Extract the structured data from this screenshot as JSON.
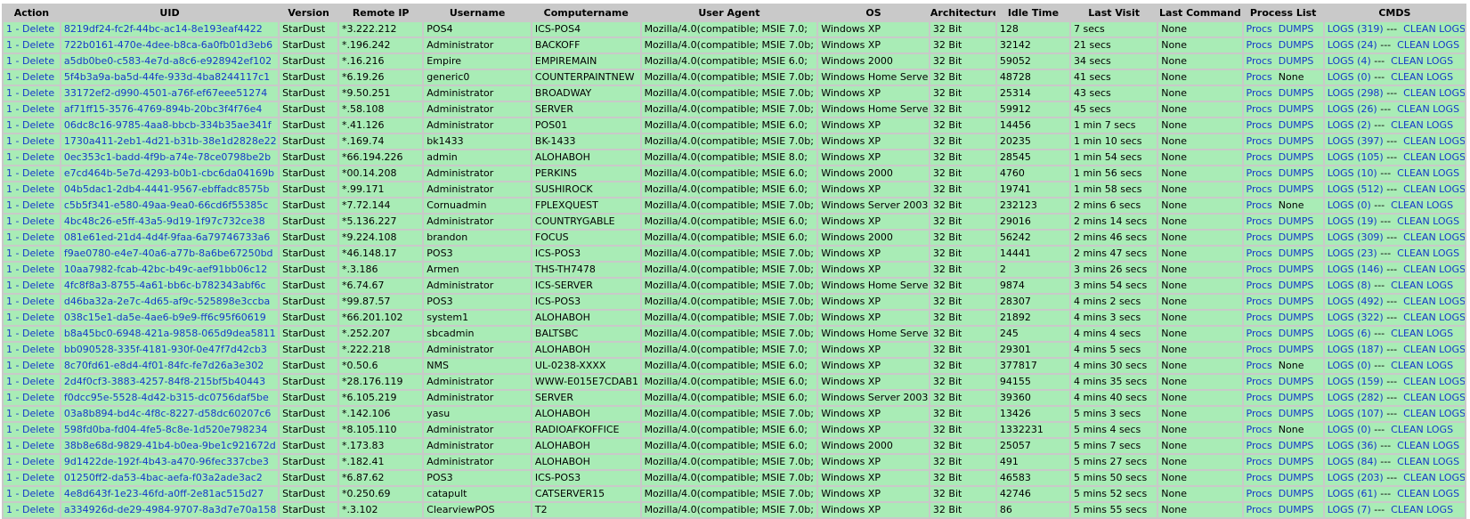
{
  "headers": [
    "Action",
    "UID",
    "Version",
    "Remote IP",
    "Username",
    "Computername",
    "User Agent",
    "OS",
    "Architecture",
    "Idle Time",
    "Last Visit",
    "Last Command",
    "Process List",
    "CMDS"
  ],
  "action_prefix": "1 -",
  "action_label": "Delete",
  "procs_label": "Procs",
  "dumps_label": "DUMPS",
  "cmds_separator": "---",
  "clean_label": "CLEAN LOGS",
  "rows": [
    {
      "uid": "8219df24-fc2f-44bc-ac14-8e193eaf4422",
      "version": "StarDust",
      "ip": "*3.222.212",
      "user": "POS4",
      "comp": "ICS-POS4",
      "ua": "Mozilla/4.0(compatible; MSIE 7.0;",
      "os": "Windows XP",
      "arch": "32 Bit",
      "idle": "128",
      "visit": "7 secs",
      "cmd": "None",
      "dumps": "DUMPS",
      "logs": "LOGS (319)"
    },
    {
      "uid": "722b0161-470e-4dee-b8ca-6a0fb01d3eb6",
      "version": "StarDust",
      "ip": "*.196.242",
      "user": "Administrator",
      "comp": "BACKOFF",
      "ua": "Mozilla/4.0(compatible; MSIE 7.0b;",
      "os": "Windows XP",
      "arch": "32 Bit",
      "idle": "32142",
      "visit": "21 secs",
      "cmd": "None",
      "dumps": "DUMPS",
      "logs": "LOGS (24)"
    },
    {
      "uid": "a5db0be0-c583-4e7d-a8c6-e928942ef102",
      "version": "StarDust",
      "ip": "*.16.216",
      "user": "Empire",
      "comp": "EMPIREMAIN",
      "ua": "Mozilla/4.0(compatible; MSIE 6.0;",
      "os": "Windows 2000",
      "arch": "32 Bit",
      "idle": "59052",
      "visit": "34 secs",
      "cmd": "None",
      "dumps": "DUMPS",
      "logs": "LOGS (4)"
    },
    {
      "uid": "5f4b3a9a-ba5d-44fe-933d-4ba8244117c1",
      "version": "StarDust",
      "ip": "*6.19.26",
      "user": "generic0",
      "comp": "COUNTERPAINTNEW",
      "ua": "Mozilla/4.0(compatible; MSIE 7.0b;",
      "os": "Windows Home Server",
      "arch": "32 Bit",
      "idle": "48728",
      "visit": "41 secs",
      "cmd": "None",
      "dumps": "None",
      "logs": "LOGS (0)"
    },
    {
      "uid": "33172ef2-d990-4501-a76f-ef67eee51274",
      "version": "StarDust",
      "ip": "*9.50.251",
      "user": "Administrator",
      "comp": "BROADWAY",
      "ua": "Mozilla/4.0(compatible; MSIE 7.0b;",
      "os": "Windows XP",
      "arch": "32 Bit",
      "idle": "25314",
      "visit": "43 secs",
      "cmd": "None",
      "dumps": "DUMPS",
      "logs": "LOGS (298)"
    },
    {
      "uid": "af71ff15-3576-4769-894b-20bc3f4f76e4",
      "version": "StarDust",
      "ip": "*.58.108",
      "user": "Administrator",
      "comp": "SERVER",
      "ua": "Mozilla/4.0(compatible; MSIE 7.0b;",
      "os": "Windows Home Server",
      "arch": "32 Bit",
      "idle": "59912",
      "visit": "45 secs",
      "cmd": "None",
      "dumps": "DUMPS",
      "logs": "LOGS (26)"
    },
    {
      "uid": "06dc8c16-9785-4aa8-bbcb-334b35ae341f",
      "version": "StarDust",
      "ip": "*.41.126",
      "user": "Administrator",
      "comp": "POS01",
      "ua": "Mozilla/4.0(compatible; MSIE 6.0;",
      "os": "Windows XP",
      "arch": "32 Bit",
      "idle": "14456",
      "visit": "1 min 7 secs",
      "cmd": "None",
      "dumps": "DUMPS",
      "logs": "LOGS (2)"
    },
    {
      "uid": "1730a411-2eb1-4d21-b31b-38e1d2828e22",
      "version": "StarDust",
      "ip": "*.169.74",
      "user": "bk1433",
      "comp": "BK-1433",
      "ua": "Mozilla/4.0(compatible; MSIE 7.0b;",
      "os": "Windows XP",
      "arch": "32 Bit",
      "idle": "20235",
      "visit": "1 min 10 secs",
      "cmd": "None",
      "dumps": "DUMPS",
      "logs": "LOGS (397)"
    },
    {
      "uid": "0ec353c1-badd-4f9b-a74e-78ce0798be2b",
      "version": "StarDust",
      "ip": "*66.194.226",
      "user": "admin",
      "comp": "ALOHABOH",
      "ua": "Mozilla/4.0(compatible; MSIE 8.0;",
      "os": "Windows XP",
      "arch": "32 Bit",
      "idle": "28545",
      "visit": "1 min 54 secs",
      "cmd": "None",
      "dumps": "DUMPS",
      "logs": "LOGS (105)"
    },
    {
      "uid": "e7cd464b-5e7d-4293-b0b1-cbc6da04169b",
      "version": "StarDust",
      "ip": "*00.14.208",
      "user": "Administrator",
      "comp": "PERKINS",
      "ua": "Mozilla/4.0(compatible; MSIE 6.0;",
      "os": "Windows 2000",
      "arch": "32 Bit",
      "idle": "4760",
      "visit": "1 min 56 secs",
      "cmd": "None",
      "dumps": "DUMPS",
      "logs": "LOGS (10)"
    },
    {
      "uid": "04b5dac1-2db4-4441-9567-ebffadc8575b",
      "version": "StarDust",
      "ip": "*.99.171",
      "user": "Administrator",
      "comp": "SUSHIROCK",
      "ua": "Mozilla/4.0(compatible; MSIE 6.0;",
      "os": "Windows XP",
      "arch": "32 Bit",
      "idle": "19741",
      "visit": "1 min 58 secs",
      "cmd": "None",
      "dumps": "DUMPS",
      "logs": "LOGS (512)"
    },
    {
      "uid": "c5b5f341-e580-49aa-9ea0-66cd6f55385c",
      "version": "StarDust",
      "ip": "*7.72.144",
      "user": "Cornuadmin",
      "comp": "FPLEXQUEST",
      "ua": "Mozilla/4.0(compatible; MSIE 7.0b;",
      "os": "Windows Server 2003",
      "arch": "32 Bit",
      "idle": "232123",
      "visit": "2 mins 6 secs",
      "cmd": "None",
      "dumps": "None",
      "logs": "LOGS (0)"
    },
    {
      "uid": "4bc48c26-e5ff-43a5-9d19-1f97c732ce38",
      "version": "StarDust",
      "ip": "*5.136.227",
      "user": "Administrator",
      "comp": "COUNTRYGABLE",
      "ua": "Mozilla/4.0(compatible; MSIE 6.0;",
      "os": "Windows XP",
      "arch": "32 Bit",
      "idle": "29016",
      "visit": "2 mins 14 secs",
      "cmd": "None",
      "dumps": "DUMPS",
      "logs": "LOGS (19)"
    },
    {
      "uid": "081e61ed-21d4-4d4f-9faa-6a79746733a6",
      "version": "StarDust",
      "ip": "*9.224.108",
      "user": "brandon",
      "comp": "FOCUS",
      "ua": "Mozilla/4.0(compatible; MSIE 6.0;",
      "os": "Windows 2000",
      "arch": "32 Bit",
      "idle": "56242",
      "visit": "2 mins 46 secs",
      "cmd": "None",
      "dumps": "DUMPS",
      "logs": "LOGS (309)"
    },
    {
      "uid": "f9ae0780-e4e7-40a6-a77b-8a6be67250bd",
      "version": "StarDust",
      "ip": "*46.148.17",
      "user": "POS3",
      "comp": "ICS-POS3",
      "ua": "Mozilla/4.0(compatible; MSIE 7.0b;",
      "os": "Windows XP",
      "arch": "32 Bit",
      "idle": "14441",
      "visit": "2 mins 47 secs",
      "cmd": "None",
      "dumps": "DUMPS",
      "logs": "LOGS (23)"
    },
    {
      "uid": "10aa7982-fcab-42bc-b49c-aef91bb06c12",
      "version": "StarDust",
      "ip": "*.3.186",
      "user": "Armen",
      "comp": "THS-TH7478",
      "ua": "Mozilla/4.0(compatible; MSIE 7.0b;",
      "os": "Windows XP",
      "arch": "32 Bit",
      "idle": "2",
      "visit": "3 mins 26 secs",
      "cmd": "None",
      "dumps": "DUMPS",
      "logs": "LOGS (146)"
    },
    {
      "uid": "4fc8f8a3-8755-4a61-bb6c-b782343abf6c",
      "version": "StarDust",
      "ip": "*6.74.67",
      "user": "Administrator",
      "comp": "ICS-SERVER",
      "ua": "Mozilla/4.0(compatible; MSIE 7.0b;",
      "os": "Windows Home Server",
      "arch": "32 Bit",
      "idle": "9874",
      "visit": "3 mins 54 secs",
      "cmd": "None",
      "dumps": "DUMPS",
      "logs": "LOGS (8)"
    },
    {
      "uid": "d46ba32a-2e7c-4d65-af9c-525898e3ccba",
      "version": "StarDust",
      "ip": "*99.87.57",
      "user": "POS3",
      "comp": "ICS-POS3",
      "ua": "Mozilla/4.0(compatible; MSIE 7.0b;",
      "os": "Windows XP",
      "arch": "32 Bit",
      "idle": "28307",
      "visit": "4 mins 2 secs",
      "cmd": "None",
      "dumps": "DUMPS",
      "logs": "LOGS (492)"
    },
    {
      "uid": "038c15e1-da5e-4ae6-b9e9-ff6c95f60619",
      "version": "StarDust",
      "ip": "*66.201.102",
      "user": "system1",
      "comp": "ALOHABOH",
      "ua": "Mozilla/4.0(compatible; MSIE 7.0b;",
      "os": "Windows XP",
      "arch": "32 Bit",
      "idle": "21892",
      "visit": "4 mins 3 secs",
      "cmd": "None",
      "dumps": "DUMPS",
      "logs": "LOGS (322)"
    },
    {
      "uid": "b8a45bc0-6948-421a-9858-065d9dea5811",
      "version": "StarDust",
      "ip": "*.252.207",
      "user": "sbcadmin",
      "comp": "BALTSBC",
      "ua": "Mozilla/4.0(compatible; MSIE 7.0b;",
      "os": "Windows Home Server",
      "arch": "32 Bit",
      "idle": "245",
      "visit": "4 mins 4 secs",
      "cmd": "None",
      "dumps": "DUMPS",
      "logs": "LOGS (6)"
    },
    {
      "uid": "bb090528-335f-4181-930f-0e47f7d42cb3",
      "version": "StarDust",
      "ip": "*.222.218",
      "user": "Administrator",
      "comp": "ALOHABOH",
      "ua": "Mozilla/4.0(compatible; MSIE 7.0;",
      "os": "Windows XP",
      "arch": "32 Bit",
      "idle": "29301",
      "visit": "4 mins 5 secs",
      "cmd": "None",
      "dumps": "DUMPS",
      "logs": "LOGS (187)"
    },
    {
      "uid": "8c70fd61-e8d4-4f01-84fc-fe7d26a3e302",
      "version": "StarDust",
      "ip": "*0.50.6",
      "user": "NMS",
      "comp": "UL-0238-XXXX",
      "ua": "Mozilla/4.0(compatible; MSIE 6.0;",
      "os": "Windows XP",
      "arch": "32 Bit",
      "idle": "377817",
      "visit": "4 mins 30 secs",
      "cmd": "None",
      "dumps": "None",
      "logs": "LOGS (0)"
    },
    {
      "uid": "2d4f0cf3-3883-4257-84f8-215bf5b40443",
      "version": "StarDust",
      "ip": "*28.176.119",
      "user": "Administrator",
      "comp": "WWW-E015E7CDAB1",
      "ua": "Mozilla/4.0(compatible; MSIE 6.0;",
      "os": "Windows XP",
      "arch": "32 Bit",
      "idle": "94155",
      "visit": "4 mins 35 secs",
      "cmd": "None",
      "dumps": "DUMPS",
      "logs": "LOGS (159)"
    },
    {
      "uid": "f0dcc95e-5528-4d42-b315-dc0756daf5be",
      "version": "StarDust",
      "ip": "*6.105.219",
      "user": "Administrator",
      "comp": "SERVER",
      "ua": "Mozilla/4.0(compatible; MSIE 6.0;",
      "os": "Windows Server 2003",
      "arch": "32 Bit",
      "idle": "39360",
      "visit": "4 mins 40 secs",
      "cmd": "None",
      "dumps": "DUMPS",
      "logs": "LOGS (282)"
    },
    {
      "uid": "03a8b894-bd4c-4f8c-8227-d58dc60207c6",
      "version": "StarDust",
      "ip": "*.142.106",
      "user": "yasu",
      "comp": "ALOHABOH",
      "ua": "Mozilla/4.0(compatible; MSIE 7.0b;",
      "os": "Windows XP",
      "arch": "32 Bit",
      "idle": "13426",
      "visit": "5 mins 3 secs",
      "cmd": "None",
      "dumps": "DUMPS",
      "logs": "LOGS (107)"
    },
    {
      "uid": "598fd0ba-fd04-4fe5-8c8e-1d520e798234",
      "version": "StarDust",
      "ip": "*8.105.110",
      "user": "Administrator",
      "comp": "RADIOAFKOFFICE",
      "ua": "Mozilla/4.0(compatible; MSIE 6.0;",
      "os": "Windows XP",
      "arch": "32 Bit",
      "idle": "1332231",
      "visit": "5 mins 4 secs",
      "cmd": "None",
      "dumps": "None",
      "logs": "LOGS (0)"
    },
    {
      "uid": "38b8e68d-9829-41b4-b0ea-9be1c921672d",
      "version": "StarDust",
      "ip": "*.173.83",
      "user": "Administrator",
      "comp": "ALOHABOH",
      "ua": "Mozilla/4.0(compatible; MSIE 6.0;",
      "os": "Windows 2000",
      "arch": "32 Bit",
      "idle": "25057",
      "visit": "5 mins 7 secs",
      "cmd": "None",
      "dumps": "DUMPS",
      "logs": "LOGS (36)"
    },
    {
      "uid": "9d1422de-192f-4b43-a470-96fec337cbe3",
      "version": "StarDust",
      "ip": "*.182.41",
      "user": "Administrator",
      "comp": "ALOHABOH",
      "ua": "Mozilla/4.0(compatible; MSIE 7.0b;",
      "os": "Windows XP",
      "arch": "32 Bit",
      "idle": "491",
      "visit": "5 mins 27 secs",
      "cmd": "None",
      "dumps": "DUMPS",
      "logs": "LOGS (84)"
    },
    {
      "uid": "01250ff2-da53-4bac-aefa-f03a2ade3ac2",
      "version": "StarDust",
      "ip": "*6.87.62",
      "user": "POS3",
      "comp": "ICS-POS3",
      "ua": "Mozilla/4.0(compatible; MSIE 7.0b;",
      "os": "Windows XP",
      "arch": "32 Bit",
      "idle": "46583",
      "visit": "5 mins 50 secs",
      "cmd": "None",
      "dumps": "DUMPS",
      "logs": "LOGS (203)"
    },
    {
      "uid": "4e8d643f-1e23-46fd-a0ff-2e81ac515d27",
      "version": "StarDust",
      "ip": "*0.250.69",
      "user": "catapult",
      "comp": "CATSERVER15",
      "ua": "Mozilla/4.0(compatible; MSIE 7.0b;",
      "os": "Windows XP",
      "arch": "32 Bit",
      "idle": "42746",
      "visit": "5 mins 52 secs",
      "cmd": "None",
      "dumps": "DUMPS",
      "logs": "LOGS (61)"
    },
    {
      "uid": "a334926d-de29-4984-9707-8a3d7e70a158",
      "version": "StarDust",
      "ip": "*.3.102",
      "user": "ClearviewPOS",
      "comp": "T2",
      "ua": "Mozilla/4.0(compatible; MSIE 7.0b;",
      "os": "Windows XP",
      "arch": "32 Bit",
      "idle": "86",
      "visit": "5 mins 55 secs",
      "cmd": "None",
      "dumps": "DUMPS",
      "logs": "LOGS (7)"
    }
  ]
}
